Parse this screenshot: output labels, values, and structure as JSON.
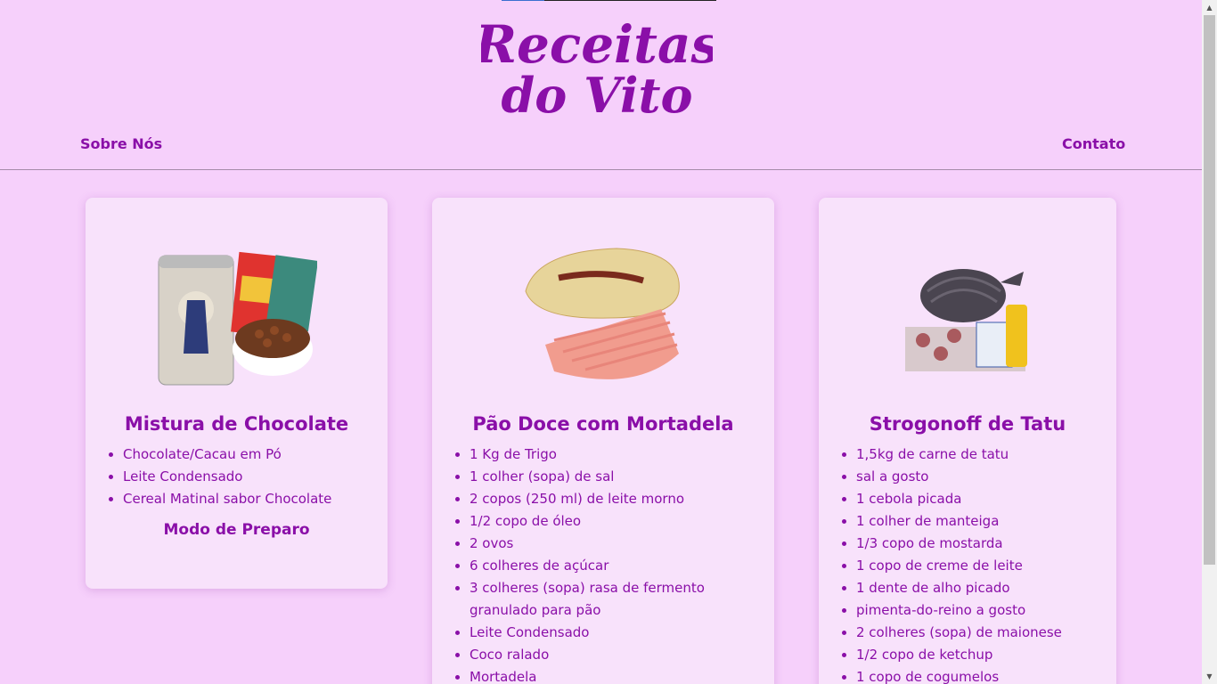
{
  "brand": {
    "logo_line1": "Receitas",
    "logo_line2": "do Vito"
  },
  "nav": {
    "about": "Sobre Nós",
    "contact": "Contato"
  },
  "recipes": [
    {
      "title": "Mistura de Chocolate",
      "image_icon": "chocolate-products-icon",
      "ingredients": [
        "Chocolate/Cacau em Pó",
        "Leite Condensado",
        "Cereal Matinal sabor Chocolate"
      ],
      "method_heading": "Modo de Preparo"
    },
    {
      "title": "Pão Doce com Mortadela",
      "image_icon": "bread-mortadella-icon",
      "ingredients": [
        "1 Kg de Trigo",
        "1 colher (sopa) de sal",
        "2 copos (250 ml) de leite morno",
        "1/2 copo de óleo",
        "2 ovos",
        "6 colheres de açúcar",
        "3 colheres (sopa) rasa de fermento granulado para pão",
        "Leite Condensado",
        "Coco ralado",
        "Mortadela"
      ]
    },
    {
      "title": "Strogonoff de Tatu",
      "image_icon": "armadillo-ingredients-icon",
      "ingredients": [
        "1,5kg de carne de tatu",
        "sal a gosto",
        "1 cebola picada",
        "1 colher de manteiga",
        "1/3 copo de mostarda",
        "1 copo de creme de leite",
        "1 dente de alho picado",
        "pimenta-do-reino a gosto",
        "2 colheres (sopa) de maionese",
        "1/2 copo de ketchup",
        "1 copo de cogumelos"
      ]
    }
  ],
  "colors": {
    "background": "#f6d0fb",
    "card": "#f8e2fb",
    "accent": "#8a0fa8"
  }
}
